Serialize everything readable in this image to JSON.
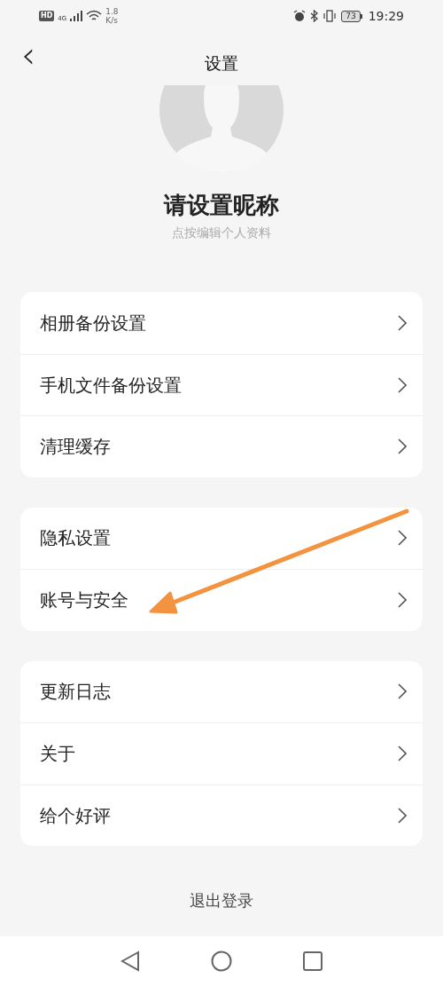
{
  "status_bar": {
    "hd": "HD",
    "network": "4G",
    "speed_value": "1.8",
    "speed_unit": "K/s",
    "battery": "73",
    "time": "19:29"
  },
  "header": {
    "back": "‹",
    "title": "设置"
  },
  "profile": {
    "nickname": "请设置昵称",
    "hint": "点按编辑个人资料"
  },
  "groups": [
    {
      "items": [
        {
          "label": "相册备份设置"
        },
        {
          "label": "手机文件备份设置"
        },
        {
          "label": "清理缓存"
        }
      ]
    },
    {
      "items": [
        {
          "label": "隐私设置"
        },
        {
          "label": "账号与安全"
        }
      ]
    },
    {
      "items": [
        {
          "label": "更新日志"
        },
        {
          "label": "关于"
        },
        {
          "label": "给个好评"
        }
      ]
    }
  ],
  "logout": "退出登录"
}
